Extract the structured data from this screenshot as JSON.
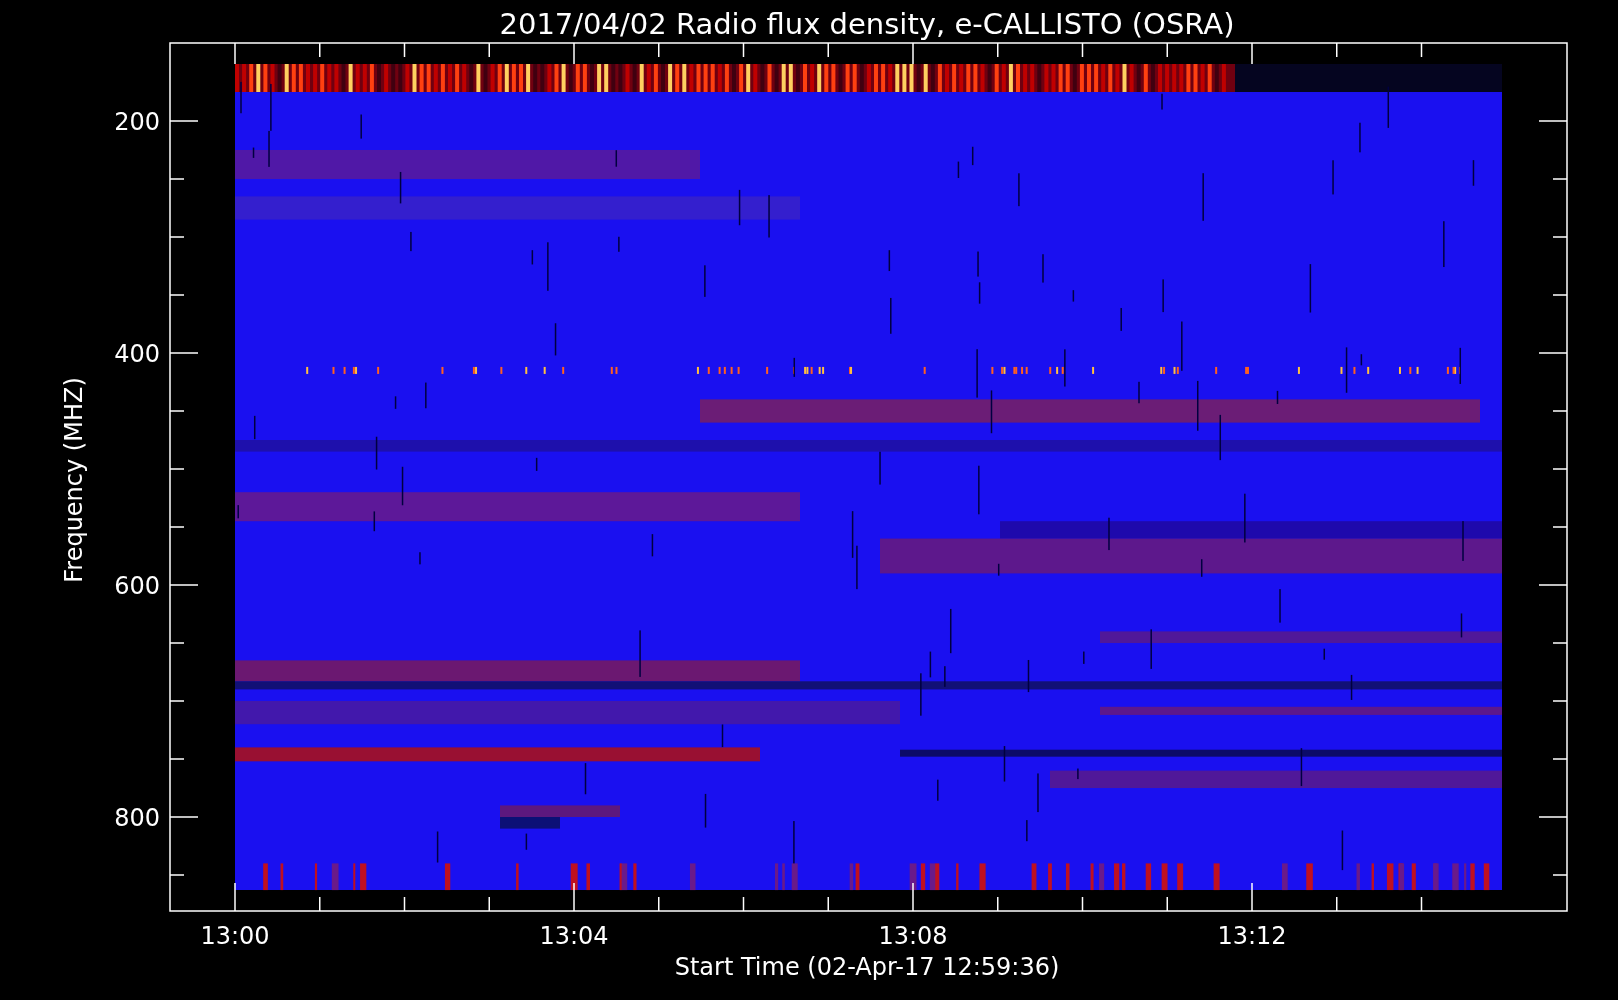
{
  "title": "2017/04/02  Radio flux density, e-CALLISTO (OSRA)",
  "y_axis": {
    "label": "Frequency (MHZ)",
    "ticks": [
      "200",
      "400",
      "600",
      "800"
    ]
  },
  "x_axis": {
    "label": "Start Time (02-Apr-17 12:59:36)",
    "ticks": [
      "13:00",
      "13:04",
      "13:08",
      "13:12"
    ]
  }
}
